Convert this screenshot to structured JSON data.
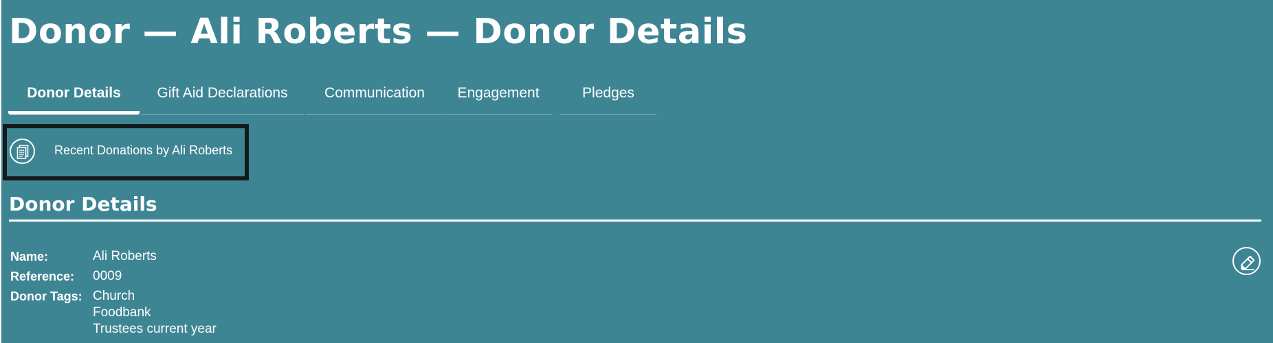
{
  "header": {
    "title": "Donor — Ali Roberts — Donor Details"
  },
  "tabs": [
    {
      "label": "Donor Details",
      "active": true
    },
    {
      "label": "Gift Aid Declarations",
      "active": false
    },
    {
      "label": "Communication",
      "active": false
    },
    {
      "label": "Engagement",
      "active": false
    },
    {
      "label": "Pledges",
      "active": false
    }
  ],
  "recent_donations": {
    "label": "Recent Donations by Ali Roberts",
    "icon": "documents-icon"
  },
  "section": {
    "title": "Donor Details",
    "edit_icon": "edit-pencil-icon"
  },
  "fields": {
    "name": {
      "label": "Name:",
      "value": "Ali Roberts"
    },
    "reference": {
      "label": "Reference:",
      "value": "0009"
    },
    "donor_tags": {
      "label": "Donor Tags:",
      "values": [
        "Church",
        "Foodbank",
        "Trustees current year"
      ]
    }
  },
  "colors": {
    "background": "#3e8594",
    "text": "#ffffff",
    "highlight_border": "#141a1c"
  }
}
